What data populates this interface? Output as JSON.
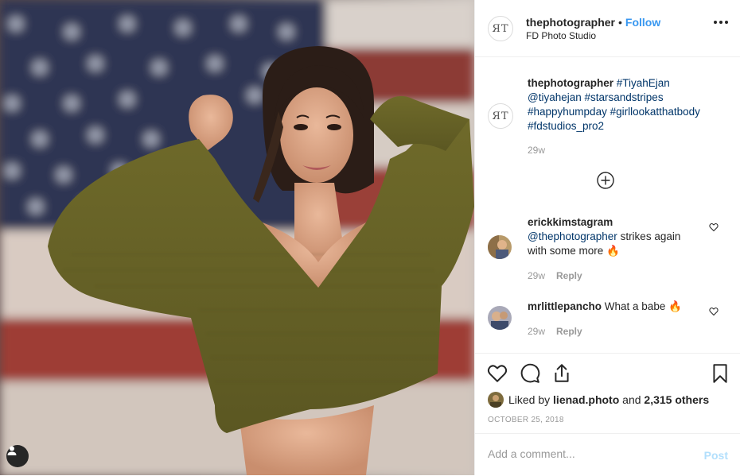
{
  "header": {
    "logo_text": "ЯT",
    "username": "thephotographer",
    "separator": "•",
    "follow_label": "Follow",
    "location": "FD Photo Studio"
  },
  "caption": {
    "username": "thephotographer",
    "tags": [
      "#TiyahEjan",
      "@tiyahejan",
      "#starsandstripes",
      "#happyhumpday",
      "#girllookatthatbody",
      "#fdstudios_pro2"
    ],
    "age": "29w"
  },
  "comments": [
    {
      "username": "erickkimstagram",
      "mention": "@thephotographer",
      "text": "strikes again with some more 🔥",
      "age": "29w",
      "reply_label": "Reply"
    },
    {
      "username": "mrlittlepancho",
      "text": "What a babe 🔥",
      "age": "29w",
      "reply_label": "Reply"
    }
  ],
  "likes": {
    "prefix": "Liked by",
    "user": "lienad.photo",
    "joiner": "and",
    "others": "2,315 others"
  },
  "date": "OCTOBER 25, 2018",
  "add_comment": {
    "placeholder": "Add a comment...",
    "post_label": "Post"
  },
  "colors": {
    "link_blue": "#3897f0",
    "hashtag": "#003569",
    "post_disabled": "#b2dffc",
    "muted": "#999999"
  },
  "icons": [
    "ellipsis-icon",
    "plus-circle-icon",
    "heart-icon",
    "comment-icon",
    "share-icon",
    "bookmark-icon",
    "user-tag-icon"
  ]
}
